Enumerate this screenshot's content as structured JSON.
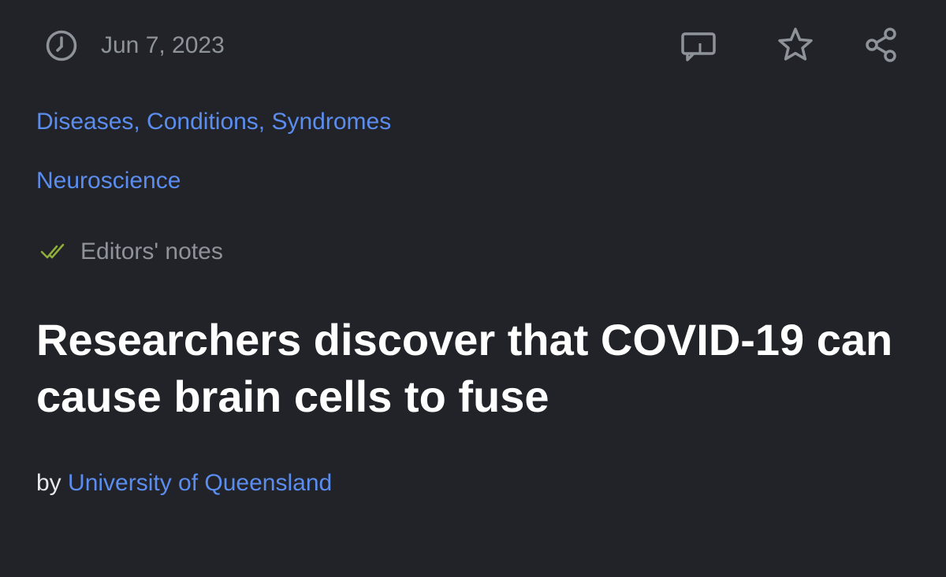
{
  "header": {
    "date": "Jun 7, 2023",
    "icons": {
      "clock": "clock-icon",
      "comments": "comments-icon",
      "bookmark": "star-icon",
      "share": "share-icon"
    }
  },
  "categories": [
    {
      "label": "Diseases, Conditions, Syndromes"
    },
    {
      "label": "Neuroscience"
    }
  ],
  "editors_notes": {
    "label": "Editors' notes",
    "icon": "double-check-icon",
    "icon_color": "#8fae3a"
  },
  "article": {
    "title": "Researchers discover that COVID-19 can cause brain cells to fuse",
    "byline_prefix": "by",
    "author": "University of Queensland"
  },
  "colors": {
    "background": "#222328",
    "link": "#5b8def",
    "muted": "#8e939a",
    "title": "#ffffff"
  }
}
